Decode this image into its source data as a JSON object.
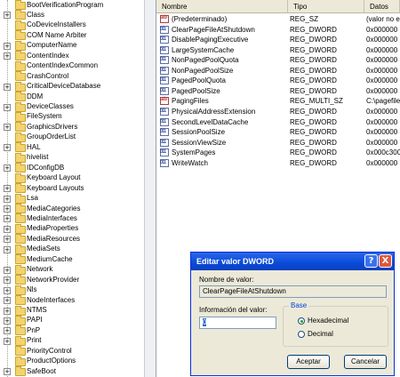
{
  "tree": {
    "items": [
      {
        "label": "BootVerificationProgram",
        "expander": ""
      },
      {
        "label": "Class",
        "expander": "+"
      },
      {
        "label": "CoDeviceInstallers",
        "expander": ""
      },
      {
        "label": "COM Name Arbiter",
        "expander": ""
      },
      {
        "label": "ComputerName",
        "expander": "+"
      },
      {
        "label": "ContentIndex",
        "expander": "+"
      },
      {
        "label": "ContentIndexCommon",
        "expander": ""
      },
      {
        "label": "CrashControl",
        "expander": ""
      },
      {
        "label": "CriticalDeviceDatabase",
        "expander": "+"
      },
      {
        "label": "DDM",
        "expander": ""
      },
      {
        "label": "DeviceClasses",
        "expander": "+"
      },
      {
        "label": "FileSystem",
        "expander": ""
      },
      {
        "label": "GraphicsDrivers",
        "expander": "+"
      },
      {
        "label": "GroupOrderList",
        "expander": ""
      },
      {
        "label": "HAL",
        "expander": "+"
      },
      {
        "label": "hivelist",
        "expander": ""
      },
      {
        "label": "IDConfigDB",
        "expander": "+"
      },
      {
        "label": "Keyboard Layout",
        "expander": ""
      },
      {
        "label": "Keyboard Layouts",
        "expander": "+"
      },
      {
        "label": "Lsa",
        "expander": "+"
      },
      {
        "label": "MediaCategories",
        "expander": "+"
      },
      {
        "label": "MediaInterfaces",
        "expander": "+"
      },
      {
        "label": "MediaProperties",
        "expander": "+"
      },
      {
        "label": "MediaResources",
        "expander": "+"
      },
      {
        "label": "MediaSets",
        "expander": "+"
      },
      {
        "label": "MediumCache",
        "expander": ""
      },
      {
        "label": "Network",
        "expander": "+"
      },
      {
        "label": "NetworkProvider",
        "expander": "+"
      },
      {
        "label": "Nls",
        "expander": "+"
      },
      {
        "label": "NodeInterfaces",
        "expander": "+"
      },
      {
        "label": "NTMS",
        "expander": "+"
      },
      {
        "label": "PAPI",
        "expander": "+"
      },
      {
        "label": "PnP",
        "expander": "+"
      },
      {
        "label": "Print",
        "expander": "+"
      },
      {
        "label": "PriorityControl",
        "expander": ""
      },
      {
        "label": "ProductOptions",
        "expander": ""
      },
      {
        "label": "SafeBoot",
        "expander": "+"
      }
    ]
  },
  "list": {
    "headers": {
      "name": "Nombre",
      "type": "Tipo",
      "data": "Datos"
    },
    "rows": [
      {
        "icon": "string-value-icon",
        "name": "(Predeterminado)",
        "type": "REG_SZ",
        "data": "(valor no e"
      },
      {
        "icon": "binary-value-icon",
        "name": "ClearPageFileAtShutdown",
        "type": "REG_DWORD",
        "data": "0x000000"
      },
      {
        "icon": "binary-value-icon",
        "name": "DisablePagingExecutive",
        "type": "REG_DWORD",
        "data": "0x000000"
      },
      {
        "icon": "binary-value-icon",
        "name": "LargeSystemCache",
        "type": "REG_DWORD",
        "data": "0x000000"
      },
      {
        "icon": "binary-value-icon",
        "name": "NonPagedPoolQuota",
        "type": "REG_DWORD",
        "data": "0x000000"
      },
      {
        "icon": "binary-value-icon",
        "name": "NonPagedPoolSize",
        "type": "REG_DWORD",
        "data": "0x000000"
      },
      {
        "icon": "binary-value-icon",
        "name": "PagedPoolQuota",
        "type": "REG_DWORD",
        "data": "0x000000"
      },
      {
        "icon": "binary-value-icon",
        "name": "PagedPoolSize",
        "type": "REG_DWORD",
        "data": "0x000000"
      },
      {
        "icon": "string-value-icon",
        "name": "PagingFiles",
        "type": "REG_MULTI_SZ",
        "data": "C:\\pagefile"
      },
      {
        "icon": "binary-value-icon",
        "name": "PhysicalAddressExtension",
        "type": "REG_DWORD",
        "data": "0x000000"
      },
      {
        "icon": "binary-value-icon",
        "name": "SecondLevelDataCache",
        "type": "REG_DWORD",
        "data": "0x000000"
      },
      {
        "icon": "binary-value-icon",
        "name": "SessionPoolSize",
        "type": "REG_DWORD",
        "data": "0x000000"
      },
      {
        "icon": "binary-value-icon",
        "name": "SessionViewSize",
        "type": "REG_DWORD",
        "data": "0x000000"
      },
      {
        "icon": "binary-value-icon",
        "name": "SystemPages",
        "type": "REG_DWORD",
        "data": "0x000c300"
      },
      {
        "icon": "binary-value-icon",
        "name": "WriteWatch",
        "type": "REG_DWORD",
        "data": "0x000000"
      }
    ]
  },
  "dialog": {
    "title": "Editar valor DWORD",
    "help_glyph": "?",
    "close_glyph": "X",
    "value_name_label": "Nombre de valor:",
    "value_name": "ClearPageFileAtShutdown",
    "value_data_label": "Información del valor:",
    "value_data": "0",
    "base_label": "Base",
    "hex_label": "Hexadecimal",
    "dec_label": "Decimal",
    "selected_base": "Hexadecimal",
    "ok_label": "Aceptar",
    "cancel_label": "Cancelar"
  },
  "colors": {
    "titlebar": "#0a4bd9",
    "dialog_bg": "#ece9d8",
    "group_label": "#0046d5"
  }
}
